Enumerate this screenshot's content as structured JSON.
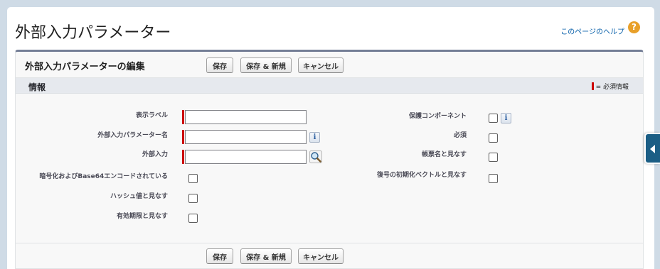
{
  "page": {
    "title": "外部入力パラメーター",
    "help_link": "このページのヘルプ",
    "help_icon": "?"
  },
  "block": {
    "title": "外部入力パラメーターの編集",
    "buttons": {
      "save": "保存",
      "save_new": "保存 & 新規",
      "cancel": "キャンセル"
    }
  },
  "section": {
    "title": "情報",
    "required_legend": "= 必須情報"
  },
  "fields": {
    "display_label": {
      "label": "表示ラベル",
      "value": ""
    },
    "param_name": {
      "label": "外部入力パラメーター名",
      "value": ""
    },
    "external_input": {
      "label": "外部入力",
      "value": ""
    },
    "encrypted_base64": {
      "label": "暗号化およびBase64エンコードされている",
      "checked": false
    },
    "hash_value": {
      "label": "ハッシュ値と見なす",
      "checked": false
    },
    "expiration": {
      "label": "有効期限と見なす",
      "checked": false
    },
    "protected_component": {
      "label": "保護コンポーネント",
      "checked": false
    },
    "required": {
      "label": "必須",
      "checked": false
    },
    "form_name": {
      "label": "帳票名と見なす",
      "checked": false
    },
    "decryption_iv": {
      "label": "復号の初期化ベクトルと見なす",
      "checked": false
    }
  },
  "icons": {
    "info": "i",
    "lookup": "magnifier-icon",
    "side_tab": "collapse-left-icon"
  },
  "colors": {
    "required": "#cc0000",
    "block_border": "#747e96",
    "side_tab": "#1b5e85",
    "link": "#015ba7"
  }
}
